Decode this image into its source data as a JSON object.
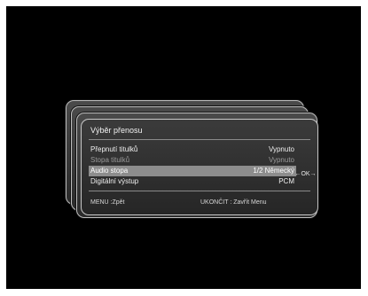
{
  "dialog": {
    "title": "Výběr přenosu",
    "rows": [
      {
        "label": "Přepnutí titulků",
        "value": "Vypnuto",
        "state": "normal"
      },
      {
        "label": "Stopa titulků",
        "value": "Vypnuto",
        "state": "disabled"
      },
      {
        "label": "Audio stopa",
        "value": "1/2 Německý",
        "state": "selected"
      },
      {
        "label": "Digitální výstup",
        "value": "PCM",
        "state": "normal"
      }
    ],
    "ok_hint": "←OK→",
    "footer": {
      "back": "MENU  :Zpět",
      "close": "UKONČIT : Zavřít Menu"
    }
  }
}
